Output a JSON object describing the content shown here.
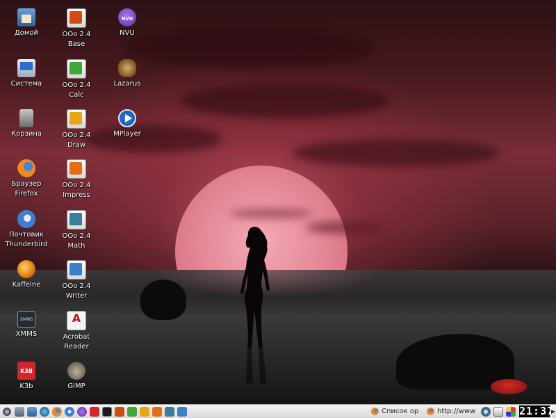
{
  "desktop_icons": {
    "home": "Домой",
    "system": "Система",
    "trash": "Корзина",
    "firefox": "Браузер\nFirefox",
    "thunderbird": "Почтовик\nThunderbird",
    "kaffeine": "Kaffeine",
    "xmms": "XMMS",
    "k3b": "K3b",
    "base": "OOo 2.4\nBase",
    "calc": "OOo 2.4\nCalc",
    "draw": "OOo 2.4\nDraw",
    "impress": "OOo 2.4\nImpress",
    "math": "OOo 2.4\nMath",
    "writer": "OOo 2.4\nWriter",
    "acrobat": "Acrobat\nReader",
    "gimp": "GIMP",
    "nvu": "NVU",
    "lazarus": "Lazarus",
    "mplayer": "MPlayer"
  },
  "taskbar": {
    "quicklaunch": [
      "kde-menu-icon",
      "show-desktop-icon",
      "home-icon",
      "network-icon",
      "firefox-icon",
      "thunderbird-icon",
      "nvu-icon",
      "k3b-icon",
      "terminal-icon",
      "base-icon",
      "calc-icon",
      "draw-icon",
      "impress-icon",
      "math-icon",
      "writer-icon"
    ],
    "task_1": "Список ор",
    "task_2": "http://www",
    "clock": "21:37"
  }
}
